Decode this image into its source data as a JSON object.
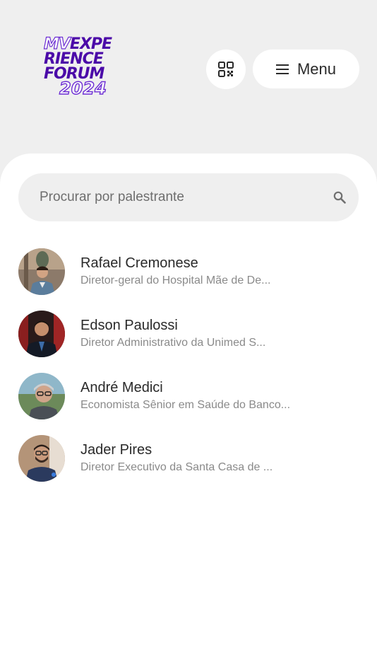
{
  "header": {
    "logo": {
      "line1_filled": "MV",
      "line1_rest": "EXPE",
      "line2": "RIENCE",
      "line3": "FORUM",
      "line4": "2024"
    },
    "qr_icon": "qr-code-icon",
    "menu_icon": "hamburger-icon",
    "menu_label": "Menu"
  },
  "search": {
    "placeholder": "Procurar por palestrante",
    "value": "",
    "icon": "search-icon"
  },
  "speakers": [
    {
      "name": "Rafael Cremonese",
      "role": "Diretor-geral do Hospital Mãe de De..."
    },
    {
      "name": "Edson Paulossi",
      "role": " Diretor Administrativo da Unimed S..."
    },
    {
      "name": "André Medici",
      "role": "Economista Sênior em Saúde do Banco..."
    },
    {
      "name": "Jader Pires",
      "role": "Diretor Executivo da Santa Casa de ..."
    }
  ],
  "colors": {
    "brand_purple": "#4b0aa8",
    "background": "#efefef",
    "card": "#ffffff"
  }
}
